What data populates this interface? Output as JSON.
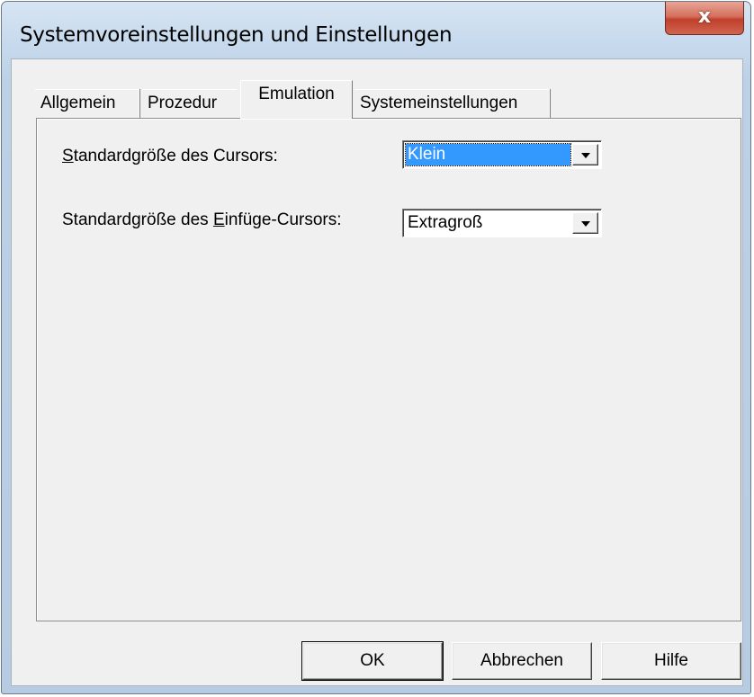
{
  "window": {
    "title": "Systemvoreinstellungen und Einstellungen",
    "close_glyph": "x"
  },
  "tabs": [
    {
      "label": "Allgemein",
      "active": false
    },
    {
      "label": "Prozedur",
      "active": false
    },
    {
      "label": "Emulation",
      "active": true
    },
    {
      "label": "Systemeinstellungen",
      "active": false
    }
  ],
  "settings": {
    "cursor_size": {
      "label_pre": "",
      "label_accel": "S",
      "label_post": "tandardgröße des Cursors:",
      "value": "Klein"
    },
    "insert_cursor_size": {
      "label_pre": "Standardgröße des ",
      "label_accel": "E",
      "label_post": "infüge-Cursors:",
      "value": "Extragroß"
    }
  },
  "buttons": {
    "ok": "OK",
    "cancel": "Abbrechen",
    "help": "Hilfe"
  },
  "colors": {
    "selection": "#3399ff",
    "close_button": "#c0402b"
  }
}
